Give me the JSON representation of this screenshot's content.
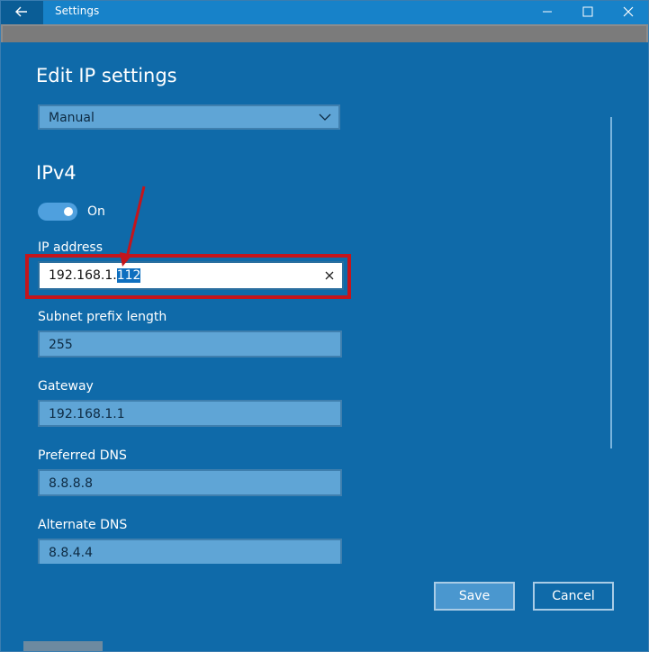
{
  "window": {
    "title": "Settings"
  },
  "page": {
    "title": "Edit IP settings"
  },
  "mode_dropdown": {
    "selected": "Manual"
  },
  "ipv4": {
    "section_title": "IPv4",
    "toggle_label": "On",
    "toggle_on": true
  },
  "fields": {
    "ip_address": {
      "label": "IP address",
      "value_prefix": "192.168.1.",
      "value_selected": "112"
    },
    "subnet": {
      "label": "Subnet prefix length",
      "value": "255"
    },
    "gateway": {
      "label": "Gateway",
      "value": "192.168.1.1"
    },
    "preferred_dns": {
      "label": "Preferred DNS",
      "value": "8.8.8.8"
    },
    "alternate_dns": {
      "label": "Alternate DNS",
      "value": "8.8.4.4"
    }
  },
  "buttons": {
    "save": "Save",
    "cancel": "Cancel"
  },
  "colors": {
    "background": "#0f6aa9",
    "titlebar": "#1782c9",
    "highlight": "#c4151c",
    "field_bg": "#5fa5d6"
  },
  "icons": {
    "back": "back-arrow-icon",
    "minimize": "minimize-icon",
    "maximize": "maximize-icon",
    "close": "close-icon",
    "dropdown": "chevron-down-icon",
    "clear": "clear-x-icon"
  }
}
